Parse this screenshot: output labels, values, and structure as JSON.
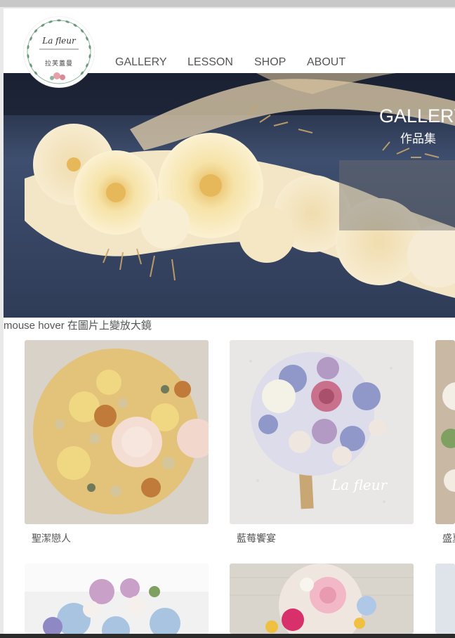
{
  "logo": {
    "title": "La fleur",
    "subtitle": "拉芙蓋曼"
  },
  "nav": {
    "items": [
      "GALLERY",
      "LESSON",
      "SHOP",
      "ABOUT"
    ]
  },
  "hero": {
    "title": "GALLERY",
    "subtitle": "作品集"
  },
  "note": "mouse hover 在圖片上變放大鏡",
  "gallery": {
    "captions": [
      "聖潔戀人",
      "藍莓饗宴",
      "盛夏"
    ],
    "watermark": "La fleur"
  },
  "colors": {
    "accent_green": "#6a9a78",
    "text": "#555555",
    "hero_denim": "#3a4a66"
  }
}
